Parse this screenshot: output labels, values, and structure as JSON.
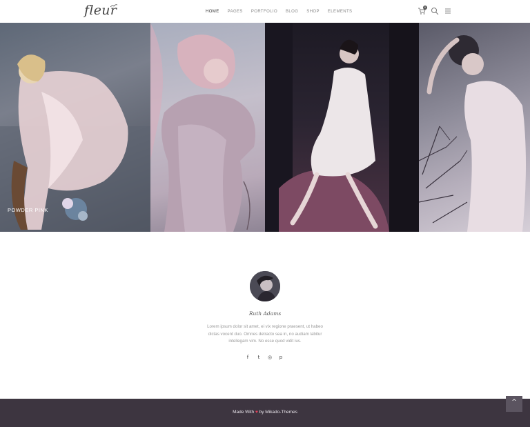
{
  "header": {
    "logo": "fleur",
    "nav": [
      {
        "label": "HOME",
        "active": true
      },
      {
        "label": "PAGES"
      },
      {
        "label": "PORTFOLIO"
      },
      {
        "label": "BLOG"
      },
      {
        "label": "SHOP"
      },
      {
        "label": "ELEMENTS"
      }
    ],
    "cart_count": "0",
    "icons": [
      "cart-icon",
      "search-icon",
      "menu-icon"
    ]
  },
  "gallery": {
    "panels": [
      {
        "caption": "POWDER PINK"
      },
      {
        "caption": ""
      },
      {
        "caption": ""
      },
      {
        "caption": ""
      }
    ]
  },
  "profile": {
    "name": "Ruth Adams",
    "bio": "Lorem ipsum dolor sit amet, ei vix regione praesent, ut habeo dictas vocent duo. Omnes detracto sea in, no audiam labitur intellegam vim. No esse quod vidit ius.",
    "socials": [
      {
        "icon": "facebook-icon",
        "glyph": "f"
      },
      {
        "icon": "twitter-icon",
        "glyph": "t"
      },
      {
        "icon": "instagram-icon",
        "glyph": "◎"
      },
      {
        "icon": "pinterest-icon",
        "glyph": "p"
      }
    ]
  },
  "footer": {
    "text_before": "Made With",
    "heart": "♥",
    "text_after": "by Mikado-Themes",
    "back_to_top": "^"
  },
  "colors": {
    "footer_bg": "#3d3540",
    "heart": "#e0405a",
    "back_top_bg": "#5b5460"
  }
}
